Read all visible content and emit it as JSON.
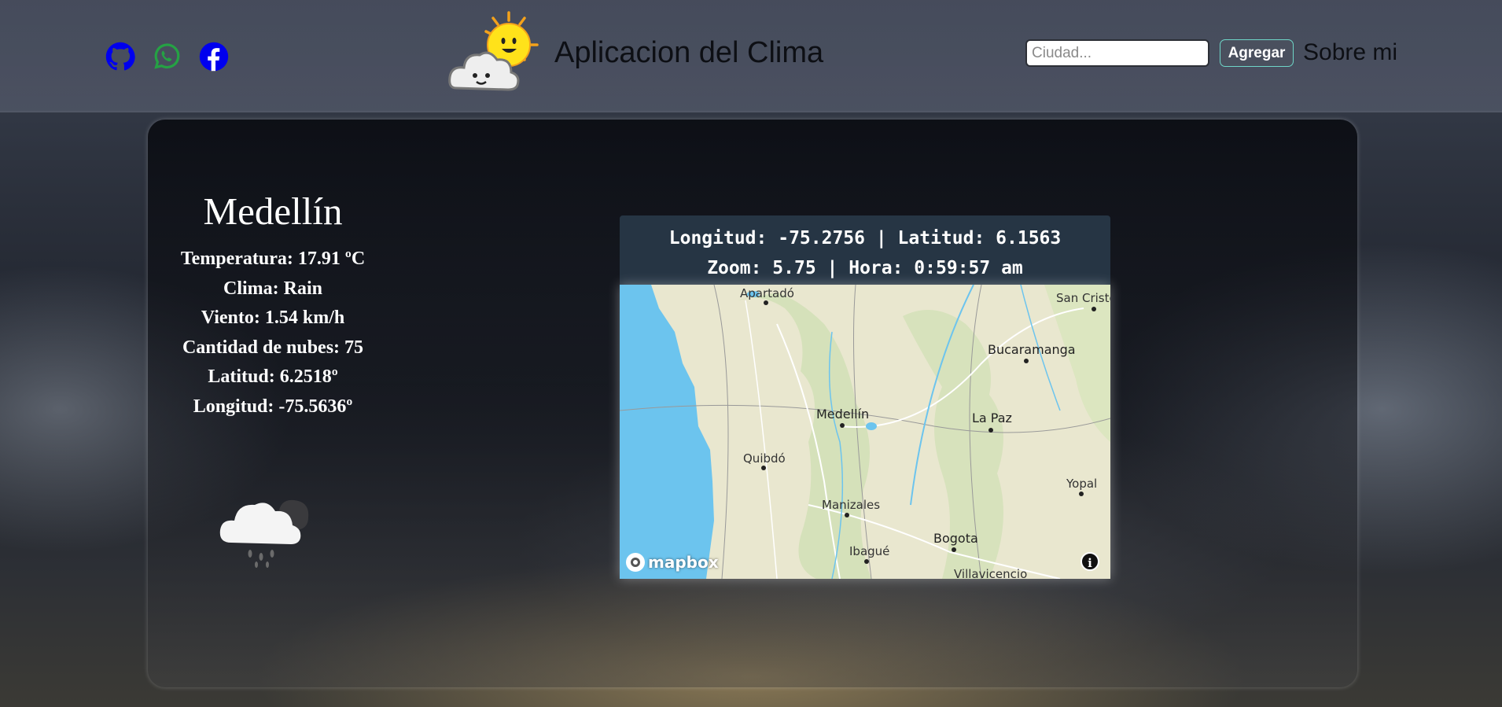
{
  "header": {
    "title": "Aplicacion del Clima",
    "search_placeholder": "Ciudad...",
    "add_button": "Agregar",
    "about_link": "Sobre mi",
    "social_icons": [
      "github-icon",
      "whatsapp-icon",
      "facebook-icon"
    ],
    "colors": {
      "github": "#0000ee",
      "whatsapp": "#25a244",
      "facebook": "#0000ee"
    }
  },
  "weather": {
    "city": "Medellín",
    "lines": [
      "Temperatura: 17.91 ºC",
      "Clima: Rain",
      "Viento: 1.54 km/h",
      "Cantidad de nubes: 75",
      "Latitud: 6.2518º",
      "Longitud: -75.5636º"
    ],
    "icon": "rain-cloud-icon"
  },
  "map": {
    "line1": "Longitud: -75.2756 | Latitud: 6.1563",
    "line2": "Zoom: 5.75 | Hora: 0:59:57 am",
    "places": [
      "Apartadó",
      "San Cristó",
      "Bucaramanga",
      "Medellín",
      "La Paz",
      "Quibdó",
      "Yopal",
      "Manizales",
      "Ibagué",
      "Bogota",
      "Villavicencio"
    ],
    "attribution": "mapbox",
    "info_button": "i"
  }
}
